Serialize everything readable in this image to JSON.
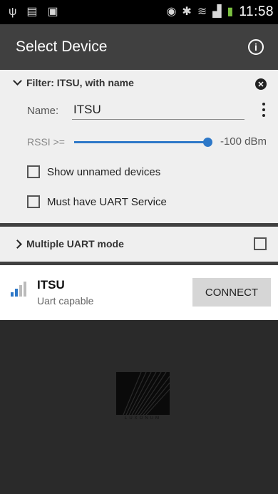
{
  "statusbar": {
    "time": "11:58"
  },
  "appbar": {
    "title": "Select Device"
  },
  "filter": {
    "header": "Filter: ITSU, with name",
    "name_label": "Name:",
    "name_value": "ITSU",
    "rssi_label": "RSSI >=",
    "rssi_value": "-100 dBm",
    "rssi_slider_fraction": 1.0,
    "show_unnamed_label": "Show unnamed devices",
    "show_unnamed_checked": false,
    "uart_label": "Must have UART Service",
    "uart_checked": false
  },
  "multi_uart": {
    "label": "Multiple UART mode",
    "checked": false
  },
  "devices": [
    {
      "name": "ITSU",
      "subtitle": "Uart capable",
      "action": "CONNECT"
    }
  ],
  "logo": {
    "text": "LUXONUM"
  },
  "colors": {
    "accent": "#2d78c8",
    "appbar": "#404040",
    "panel": "#efefef",
    "signal_weak": "#2d78c8",
    "signal_strong": "#e07020"
  }
}
